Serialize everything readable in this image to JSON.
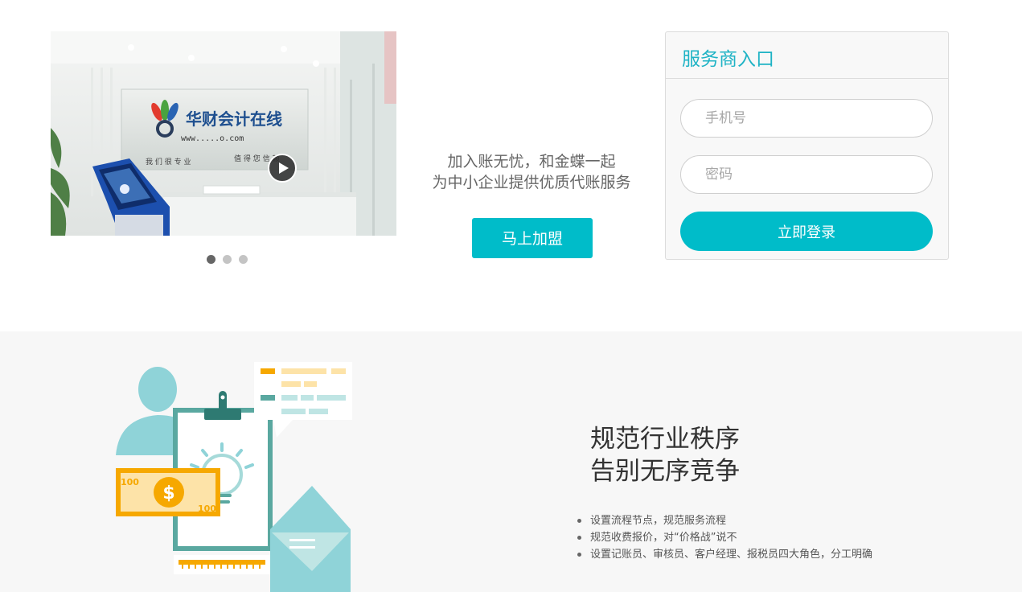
{
  "carousel": {
    "slides_count": 3,
    "active_index": 0,
    "play_icon": "play-icon",
    "image_desc_logo_text": "华财会计在线",
    "image_logo_url_text": "www.....o.com",
    "image_slogan_left": "我 们 很 专 业",
    "image_slogan_right": "值 得 您 信 赖"
  },
  "promo": {
    "line1": "加入账无忧，和金蝶一起",
    "line2": "为中小企业提供优质代账服务",
    "join_label": "马上加盟"
  },
  "login": {
    "title": "服务商入口",
    "phone_placeholder": "手机号",
    "password_placeholder": "密码",
    "submit_label": "立即登录"
  },
  "feature": {
    "heading_line1": "规范行业秩序",
    "heading_line2": "告别无序竞争",
    "bullets": [
      "设置流程节点，规范服务流程",
      "规范收费报价，对“价格战”说不",
      "设置记账员、审核员、客户经理、报税员四大角色，分工明确"
    ],
    "bill_amount_top": "100",
    "bill_amount_bottom": "100",
    "bill_symbol": "$"
  },
  "colors": {
    "accent": "#00bcc9",
    "title_teal": "#1fb3c5",
    "illus_teal": "#8fd3d8",
    "illus_dark": "#2e7a72",
    "illus_orange": "#f6a800"
  }
}
